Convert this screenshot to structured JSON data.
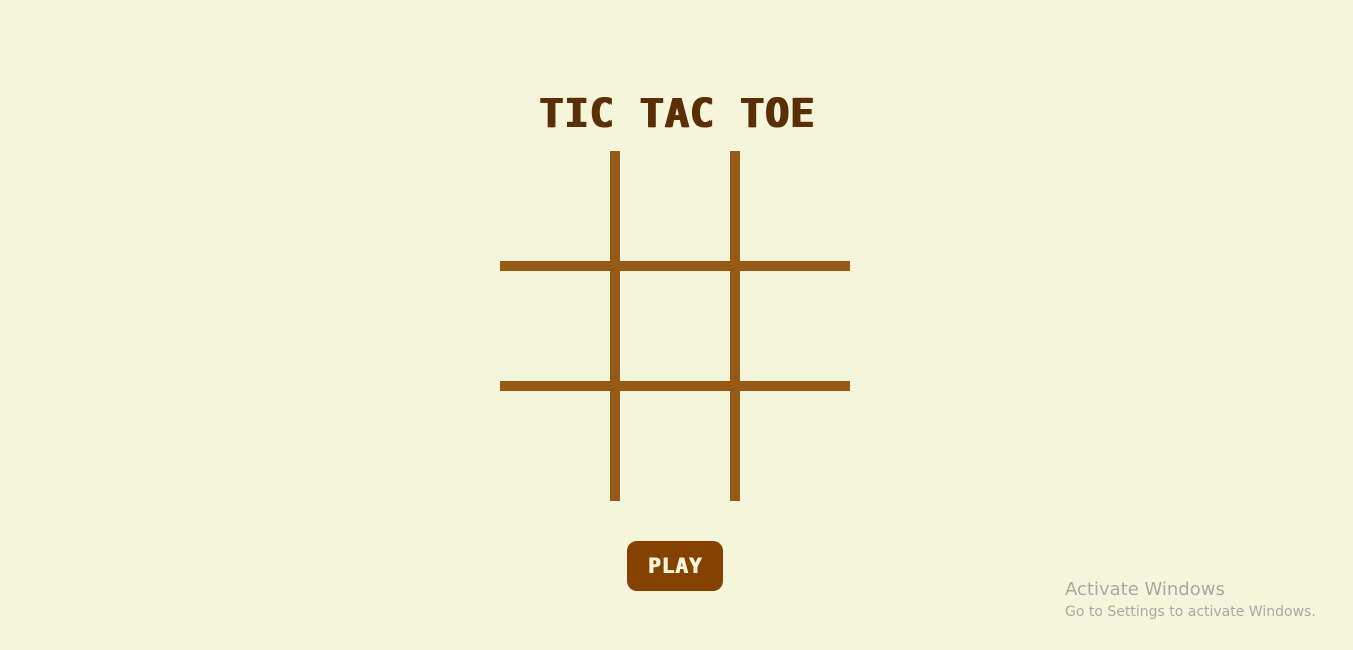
{
  "game": {
    "title": "TIC TAC TOE",
    "play_label": "PLAY",
    "board": {
      "rows": 3,
      "cols": 3,
      "cells": [
        "",
        "",
        "",
        "",
        "",
        "",
        "",
        "",
        ""
      ]
    }
  },
  "watermark": {
    "title": "Activate Windows",
    "subtitle": "Go to Settings to activate Windows."
  },
  "colors": {
    "background": "#f5f5dc",
    "title": "#5a2f06",
    "grid_lines": "#975a16",
    "button_bg": "#854100",
    "button_text": "#f5f5dc"
  }
}
